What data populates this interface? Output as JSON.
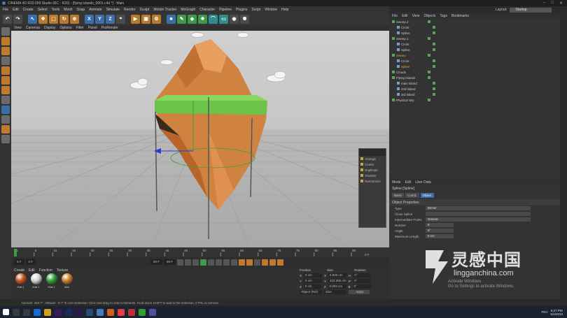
{
  "titlebar": {
    "title": "CINEMA 4D R20.059 Studio (RC - R20) - [flying islands_0001.c4d *] - Main",
    "min": "–",
    "max": "□",
    "close": "✕"
  },
  "menu": [
    "File",
    "Edit",
    "Create",
    "Select",
    "Tools",
    "Mesh",
    "Snap",
    "Animate",
    "Simulate",
    "Render",
    "Sculpt",
    "Motion Tracker",
    "MoGraph",
    "Character",
    "Pipeline",
    "Plugins",
    "Script",
    "Window",
    "Help"
  ],
  "layout": {
    "label": "Layout:",
    "value": "Startup"
  },
  "toolbar": {
    "axis_x": "X",
    "axis_y": "Y",
    "axis_z": "Z"
  },
  "viewport_menu": [
    "View",
    "Cameras",
    "Display",
    "Options",
    "Filter",
    "Panel",
    "ProRender"
  ],
  "dock_items": [
    "Arrange",
    "Center",
    "Duplicate",
    "Transfer",
    "Randomize"
  ],
  "timeline": {
    "ticks": [
      "0",
      "5",
      "10",
      "15",
      "20",
      "25",
      "30",
      "35",
      "40",
      "45",
      "50",
      "55",
      "60",
      "65",
      "70",
      "75",
      "80",
      "85",
      "90"
    ],
    "end_label": "0 F"
  },
  "transport": {
    "start": "0 F",
    "cur": "0 F",
    "end": "90 F",
    "end2": "90 F"
  },
  "material_menu": [
    "Create",
    "Edit",
    "Function",
    "Texture"
  ],
  "materials": [
    {
      "label": "Mat.1",
      "color": "#c4581f"
    },
    {
      "label": "Mat.1",
      "color": "#d6d6d6"
    },
    {
      "label": "Mat.1",
      "color": "#3aa33a"
    },
    {
      "label": "Mat",
      "color": "#c88332"
    }
  ],
  "coords": {
    "headers": [
      "Position",
      "Size",
      "Rotation"
    ],
    "rows": [
      [
        "X",
        "0 cm",
        "X",
        "6.822 cm",
        "H",
        "0°"
      ],
      [
        "Y",
        "0 cm",
        "Y",
        "422.255 cm",
        "P",
        "0°"
      ],
      [
        "Z",
        "0 cm",
        "Z",
        "0.002 cm",
        "B",
        "0°"
      ]
    ],
    "mode": "Object (Rel)",
    "size_mode": "Size",
    "apply": "Apply"
  },
  "status": "Azimuth: 284.7°, Altitude: -8.7°  E   Live Selection: Click and drag to select elements. Hold down SHIFT to add to the selection, CTRL to remove.",
  "obj_menu": [
    "File",
    "Edit",
    "View",
    "Objects",
    "Tags",
    "Bookmarks"
  ],
  "objects": [
    {
      "name": "Sweep.2",
      "indent": 0,
      "sel": false
    },
    {
      "name": "Circle",
      "indent": 1,
      "sel": false
    },
    {
      "name": "Spline",
      "indent": 1,
      "sel": false
    },
    {
      "name": "Sweep.1",
      "indent": 0,
      "sel": false
    },
    {
      "name": "Circle",
      "indent": 1,
      "sel": false
    },
    {
      "name": "Spline",
      "indent": 1,
      "sel": false
    },
    {
      "name": "Sweep",
      "indent": 0,
      "sel": true
    },
    {
      "name": "Circle",
      "indent": 1,
      "sel": false
    },
    {
      "name": "Spline",
      "indent": 1,
      "sel": true
    },
    {
      "name": "Clouds",
      "indent": 0,
      "sel": false
    },
    {
      "name": "Flying islands",
      "indent": 0,
      "sel": false
    },
    {
      "name": "main island",
      "indent": 1,
      "sel": false
    },
    {
      "name": "2nd island",
      "indent": 1,
      "sel": false
    },
    {
      "name": "3rd island",
      "indent": 1,
      "sel": false
    },
    {
      "name": "Physical Sky",
      "indent": 0,
      "sel": false
    }
  ],
  "attr_menu": [
    "Mode",
    "Edit",
    "User Data"
  ],
  "attr": {
    "object_title": "Spline [Spline]",
    "tabs": [
      "Basic",
      "Coord.",
      "Object"
    ],
    "section": "Object Properties",
    "rows": [
      {
        "label": "Type",
        "value": "Bezier"
      },
      {
        "label": "Close Spline",
        "value": ""
      },
      {
        "label": "Intermediate Points",
        "value": "Natural"
      },
      {
        "label": "Number",
        "value": "8"
      },
      {
        "label": "Angle",
        "value": "5°"
      },
      {
        "label": "Maximum Length",
        "value": "5 cm"
      }
    ]
  },
  "taskbar": {
    "lang": "FRA",
    "time": "9:27 PM",
    "date": "5/4/2019"
  },
  "watermark": {
    "cn": "灵感中国",
    "en": "lingganchina.com"
  },
  "activate": {
    "l1": "Activate Windows",
    "l2": "Go to Settings to activate Windows."
  }
}
